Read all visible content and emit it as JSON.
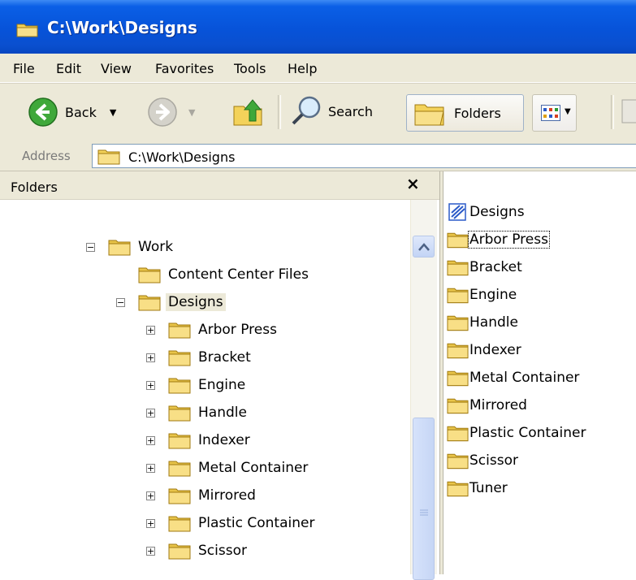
{
  "window": {
    "title": "C:\\Work\\Designs"
  },
  "menu": [
    "File",
    "Edit",
    "View",
    "Favorites",
    "Tools",
    "Help"
  ],
  "toolbar": {
    "back_label": "Back",
    "search_label": "Search",
    "folders_label": "Folders"
  },
  "address": {
    "label": "Address",
    "value": "C:\\Work\\Designs"
  },
  "folders_pane": {
    "title": "Folders",
    "close_symbol": "×",
    "tree": [
      {
        "label": "Work",
        "expander": "−"
      },
      {
        "label": "Content Center Files"
      },
      {
        "label": "Designs",
        "expander": "−",
        "selected": true
      },
      {
        "label": "Arbor Press",
        "expander": "+"
      },
      {
        "label": "Bracket",
        "expander": "+"
      },
      {
        "label": "Engine",
        "expander": "+"
      },
      {
        "label": "Handle",
        "expander": "+"
      },
      {
        "label": "Indexer",
        "expander": "+"
      },
      {
        "label": "Metal Container",
        "expander": "+"
      },
      {
        "label": "Mirrored",
        "expander": "+"
      },
      {
        "label": "Plastic Container",
        "expander": "+"
      },
      {
        "label": "Scissor",
        "expander": "+"
      }
    ]
  },
  "contents": [
    "Designs",
    "Arbor Press",
    "Bracket",
    "Engine",
    "Handle",
    "Indexer",
    "Metal Container",
    "Mirrored",
    "Plastic Container",
    "Scissor",
    "Tuner"
  ],
  "colors": {
    "title_bar": "#0753d9",
    "chrome": "#ece9d8",
    "folder": "#f5d565"
  }
}
